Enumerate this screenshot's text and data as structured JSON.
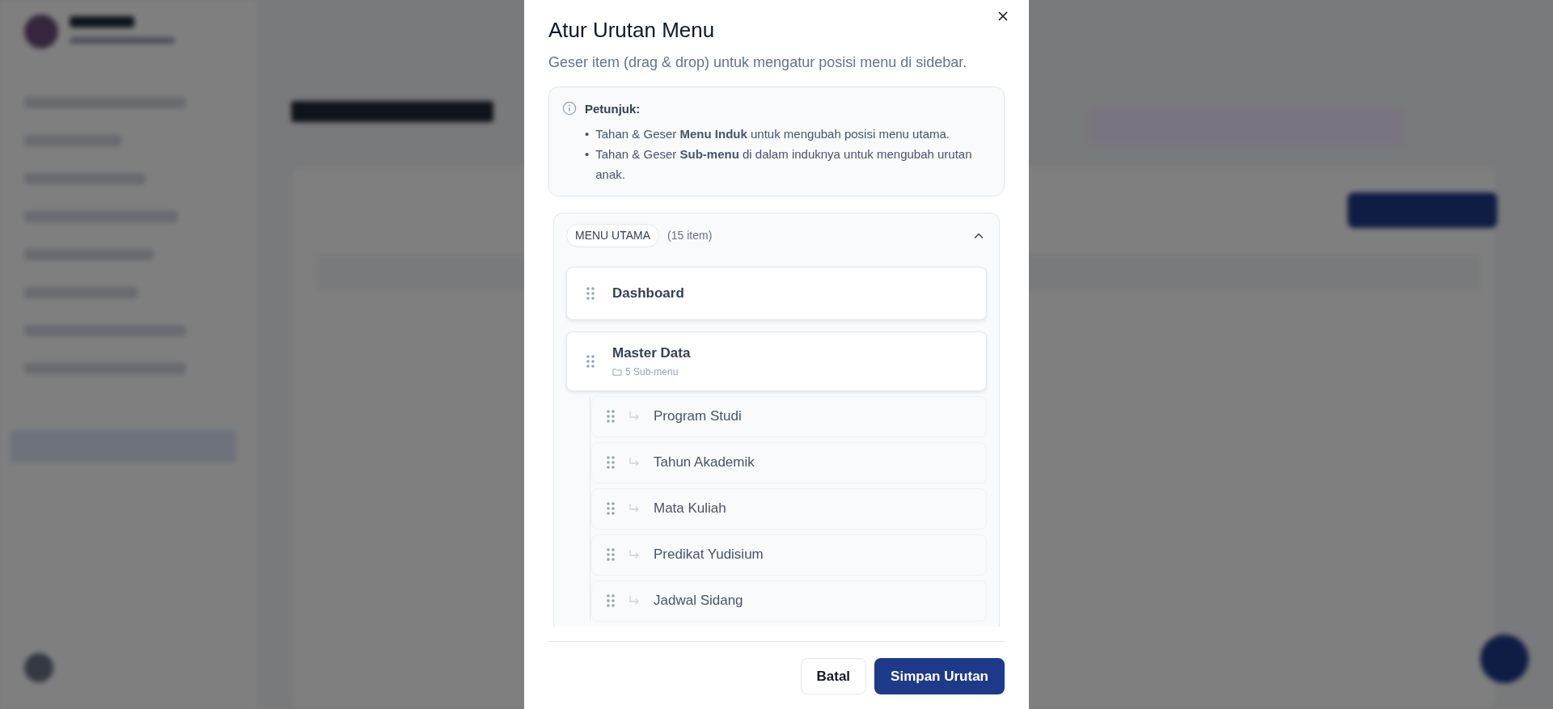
{
  "modal": {
    "title": "Atur Urutan Menu",
    "subtitle": "Geser item (drag & drop) untuk mengatur posisi menu di sidebar."
  },
  "hint": {
    "title": "Petunjuk:",
    "items": [
      {
        "bullet": "•",
        "text": "Tahan & Geser **Menu Induk** untuk mengubah posisi menu utama."
      },
      {
        "bullet": "•",
        "text": "Tahan & Geser **Sub-menu** di dalam induknya untuk mengubah urutan anak."
      }
    ]
  },
  "section": {
    "label": "MENU UTAMA",
    "count": "(15 item)",
    "expanded": true,
    "items": [
      {
        "label": "Dashboard"
      },
      {
        "label": "Master Data",
        "sublabel": "5 Sub-menu",
        "children": [
          {
            "label": "Program Studi"
          },
          {
            "label": "Tahun Akademik"
          },
          {
            "label": "Mata Kuliah"
          },
          {
            "label": "Predikat Yudisium"
          },
          {
            "label": "Jadwal Sidang"
          }
        ]
      }
    ]
  },
  "buttons": [
    {
      "label": "Batal",
      "kind": "secondary"
    },
    {
      "label": "Simpan Urutan",
      "kind": "primary"
    }
  ]
}
